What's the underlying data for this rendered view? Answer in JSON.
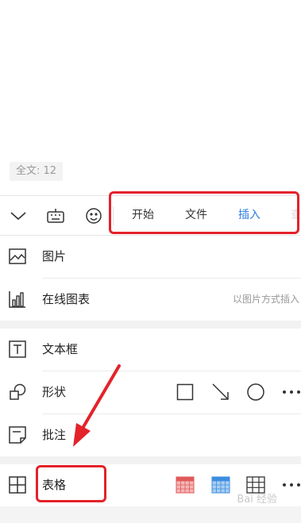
{
  "status": {
    "word_count": "全文: 12"
  },
  "toolbar": {
    "tabs": [
      {
        "label": "开始",
        "active": false
      },
      {
        "label": "文件",
        "active": false
      },
      {
        "label": "插入",
        "active": true
      }
    ],
    "cut_tab": "查",
    "icons": [
      "collapse-chevron-icon",
      "keyboard-icon",
      "emoji-icon"
    ]
  },
  "menu": {
    "picture": "图片",
    "online_chart": "在线图表",
    "online_chart_hint": "以图片方式插入",
    "textbox": "文本框",
    "shape": "形状",
    "comment": "批注",
    "table": "表格"
  },
  "watermark": "Bai 经验",
  "colors": {
    "accent": "#2f7de1",
    "annotation_red": "#e3222a"
  }
}
